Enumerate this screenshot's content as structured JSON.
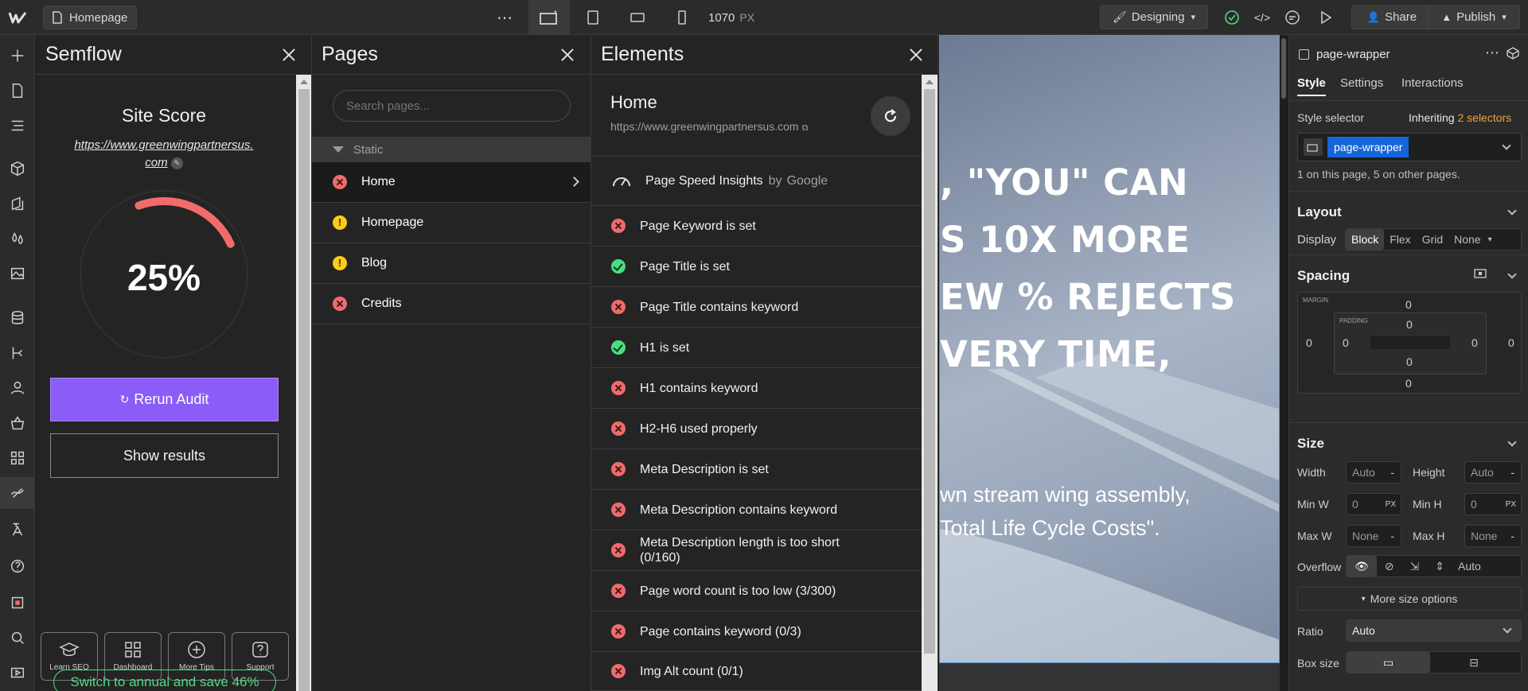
{
  "topbar": {
    "page_name": "Homepage",
    "width_value": "1070",
    "width_unit": "PX",
    "mode": "Designing",
    "share": "Share",
    "publish": "Publish"
  },
  "semflow": {
    "title": "Semflow",
    "site_score_label": "Site Score",
    "url_line1": "https://www.greenwingpartnersus.",
    "url_line2": "com",
    "score": "25%",
    "score_fraction": 0.25,
    "rerun": "Rerun Audit",
    "show_results": "Show results",
    "tiles": [
      "Learn SEO",
      "Dashboard",
      "More Tips",
      "Support"
    ],
    "promo": "Switch to annual and save 46%"
  },
  "pages": {
    "title": "Pages",
    "search_placeholder": "Search pages...",
    "group": "Static",
    "items": [
      {
        "name": "Home",
        "status": "error"
      },
      {
        "name": "Homepage",
        "status": "warning"
      },
      {
        "name": "Blog",
        "status": "warning"
      },
      {
        "name": "Credits",
        "status": "error"
      }
    ]
  },
  "elements": {
    "title": "Elements",
    "page_title": "Home",
    "url": "https://www.greenwingpartnersus.com",
    "insights": "Page Speed Insights",
    "by": "by",
    "google": "Google",
    "checks": [
      {
        "label": "Page Keyword is set",
        "status": "fail"
      },
      {
        "label": "Page Title is set",
        "status": "pass"
      },
      {
        "label": "Page Title contains keyword",
        "status": "fail"
      },
      {
        "label": "H1 is set",
        "status": "pass"
      },
      {
        "label": "H1 contains keyword",
        "status": "fail"
      },
      {
        "label": "H2-H6 used properly",
        "status": "fail"
      },
      {
        "label": "Meta Description is set",
        "status": "fail"
      },
      {
        "label": "Meta Description contains keyword",
        "status": "fail"
      },
      {
        "label": "Meta Description length is too short (0/160)",
        "status": "fail"
      },
      {
        "label": "Page word count is too low (3/300)",
        "status": "fail"
      },
      {
        "label": "Page contains keyword (0/3)",
        "status": "fail"
      },
      {
        "label": "Img Alt count (0/1)",
        "status": "fail"
      }
    ]
  },
  "canvas": {
    "lines": [
      ", \"YOU\" CAN",
      "S 10X MORE",
      "EW % REJECTS",
      "VERY TIME,"
    ],
    "sub": [
      "wn stream wing assembly,",
      "Total Life Cycle Costs\"."
    ]
  },
  "style_panel": {
    "element": "page-wrapper",
    "tabs": [
      "Style",
      "Settings",
      "Interactions"
    ],
    "style_selector": "Style selector",
    "inheriting": "Inheriting",
    "selectors_count": "2 selectors",
    "chip": "page-wrapper",
    "usage": "1 on this page, 5 on other pages.",
    "layout": "Layout",
    "display": "Display",
    "display_opts": [
      "Block",
      "Flex",
      "Grid",
      "None"
    ],
    "spacing": "Spacing",
    "margin_label": "MARGIN",
    "padding_label": "PADDING",
    "zero": "0",
    "size": "Size",
    "width": "Width",
    "height": "Height",
    "auto": "Auto",
    "dash": "-",
    "min_w": "Min W",
    "min_h": "Min H",
    "px": "PX",
    "max_w": "Max W",
    "max_h": "Max H",
    "none": "None",
    "overflow": "Overflow",
    "overflow_auto": "Auto",
    "more_size": "More size options",
    "ratio": "Ratio",
    "ratio_val": "Auto",
    "box_size": "Box size"
  },
  "colors": {
    "accent_purple": "#8b5cf6",
    "score_arc": "#f26b6b",
    "selector_blue": "#1565d8",
    "fail": "#f06b6b",
    "pass": "#4ade80",
    "warn": "#facc15",
    "promo_green": "#4ade80"
  }
}
